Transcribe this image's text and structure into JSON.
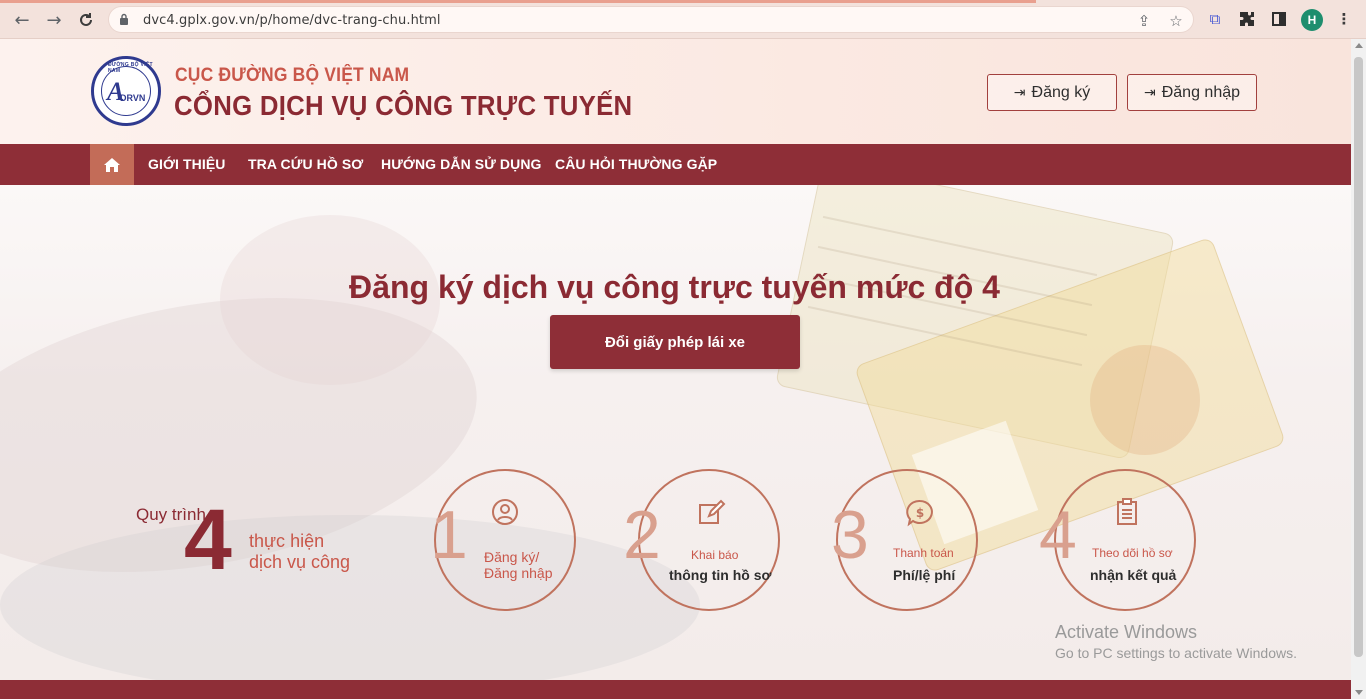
{
  "browser": {
    "url": "dvc4.gplx.gov.vn/p/home/dvc-trang-chu.html",
    "avatar_letter": "H"
  },
  "header": {
    "logo_arc_text": "ĐƯỜNG BỘ VIỆT NAM",
    "logo_text": "DRVN",
    "org_name": "CỤC ĐƯỜNG BỘ VIỆT NAM",
    "portal_name": "CỔNG DỊCH VỤ CÔNG TRỰC TUYẾN",
    "register_label": "Đăng ký",
    "login_label": "Đăng nhập"
  },
  "menu": {
    "items": [
      "GIỚI THIỆU",
      "TRA CỨU HỒ SƠ",
      "HƯỚNG DẪN SỬ DỤNG",
      "CÂU HỎI THƯỜNG GẶP"
    ]
  },
  "hero": {
    "title": "Đăng ký dịch vụ công trực tuyến mức độ 4",
    "button_label": "Đổi giấy phép lái xe"
  },
  "process": {
    "prefix": "Quy trình",
    "number": "4",
    "line1": "thực hiện",
    "line2": "dịch vụ công",
    "steps": [
      {
        "digit": "1",
        "line1": "Đăng ký/",
        "line2": "Đăng nhập",
        "icon": "user-icon"
      },
      {
        "digit": "2",
        "line1": "Khai báo",
        "line2": "thông tin hồ sơ",
        "icon": "edit-icon"
      },
      {
        "digit": "3",
        "line1": "Thanh toán",
        "line2": "Phí/lệ phí",
        "icon": "dollar-icon"
      },
      {
        "digit": "4",
        "line1": "Theo dõi hồ sơ",
        "line2": "nhận kết quả",
        "icon": "clipboard-icon"
      }
    ]
  },
  "watermark": {
    "line1": "Activate Windows",
    "line2": "Go to PC settings to activate Windows."
  },
  "colors": {
    "primary": "#8e2e37",
    "accent": "#c9574a",
    "home_button": "#c36c58"
  }
}
